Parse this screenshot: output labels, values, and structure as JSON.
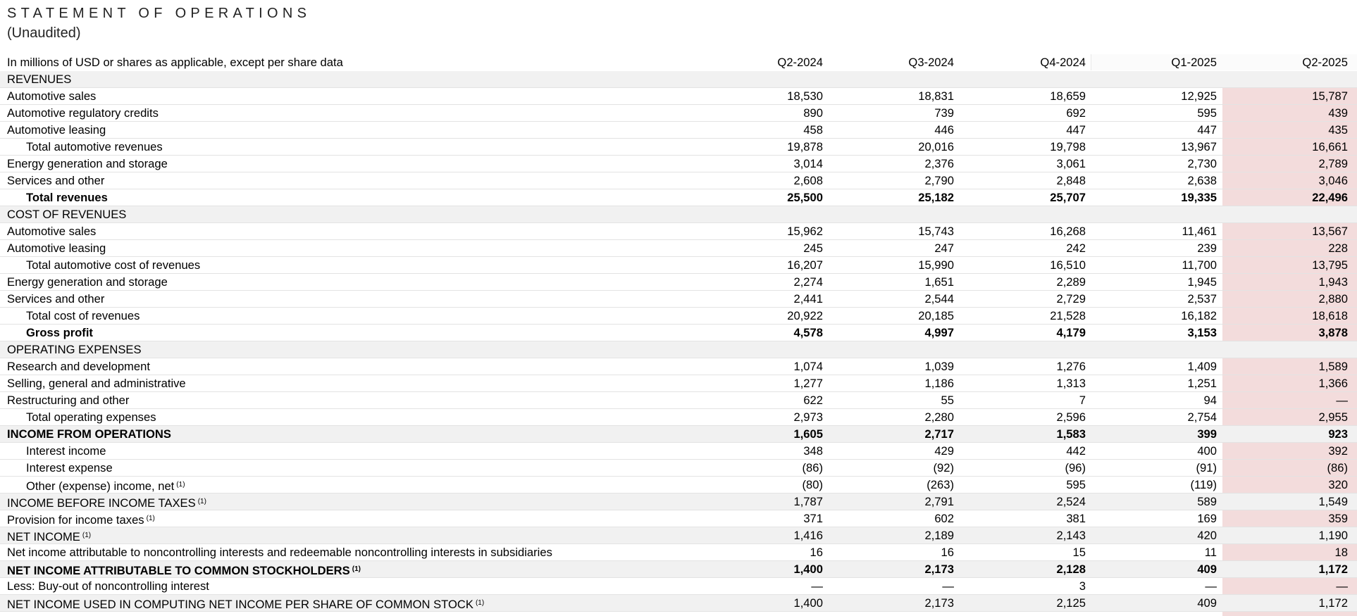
{
  "title": "STATEMENT OF OPERATIONS",
  "subtitle": "(Unaudited)",
  "header": {
    "label": "In millions of USD or shares as applicable, except per share data",
    "columns": [
      "Q2-2024",
      "Q3-2024",
      "Q4-2024",
      "Q1-2025",
      "Q2-2025"
    ]
  },
  "rows": [
    {
      "label": "REVENUES",
      "section": true
    },
    {
      "label": "Automotive sales",
      "values": [
        "18,530",
        "18,831",
        "18,659",
        "12,925",
        "15,787"
      ],
      "hl": true
    },
    {
      "label": "Automotive regulatory credits",
      "values": [
        "890",
        "739",
        "692",
        "595",
        "439"
      ],
      "hl": true
    },
    {
      "label": "Automotive leasing",
      "values": [
        "458",
        "446",
        "447",
        "447",
        "435"
      ],
      "hl": true
    },
    {
      "label": "Total automotive revenues",
      "indent": true,
      "values": [
        "19,878",
        "20,016",
        "19,798",
        "13,967",
        "16,661"
      ],
      "hl": true
    },
    {
      "label": "Energy generation and storage",
      "values": [
        "3,014",
        "2,376",
        "3,061",
        "2,730",
        "2,789"
      ],
      "hl": true
    },
    {
      "label": "Services and other",
      "values": [
        "2,608",
        "2,790",
        "2,848",
        "2,638",
        "3,046"
      ],
      "hl": true
    },
    {
      "label": "Total revenues",
      "indent": true,
      "bold": true,
      "values": [
        "25,500",
        "25,182",
        "25,707",
        "19,335",
        "22,496"
      ],
      "hl": true
    },
    {
      "label": "COST OF REVENUES",
      "section": true
    },
    {
      "label": "Automotive sales",
      "values": [
        "15,962",
        "15,743",
        "16,268",
        "11,461",
        "13,567"
      ],
      "hl": true
    },
    {
      "label": "Automotive leasing",
      "values": [
        "245",
        "247",
        "242",
        "239",
        "228"
      ],
      "hl": true
    },
    {
      "label": "Total automotive cost of revenues",
      "indent": true,
      "values": [
        "16,207",
        "15,990",
        "16,510",
        "11,700",
        "13,795"
      ],
      "hl": true
    },
    {
      "label": "Energy generation and storage",
      "values": [
        "2,274",
        "1,651",
        "2,289",
        "1,945",
        "1,943"
      ],
      "hl": true
    },
    {
      "label": "Services and other",
      "values": [
        "2,441",
        "2,544",
        "2,729",
        "2,537",
        "2,880"
      ],
      "hl": true
    },
    {
      "label": "Total cost of revenues",
      "indent": true,
      "values": [
        "20,922",
        "20,185",
        "21,528",
        "16,182",
        "18,618"
      ],
      "hl": true
    },
    {
      "label": "Gross profit",
      "indent": true,
      "bold": true,
      "values": [
        "4,578",
        "4,997",
        "4,179",
        "3,153",
        "3,878"
      ],
      "hl": true
    },
    {
      "label": "OPERATING EXPENSES",
      "section": true
    },
    {
      "label": "Research and development",
      "values": [
        "1,074",
        "1,039",
        "1,276",
        "1,409",
        "1,589"
      ],
      "hl": true
    },
    {
      "label": "Selling, general and administrative",
      "values": [
        "1,277",
        "1,186",
        "1,313",
        "1,251",
        "1,366"
      ],
      "hl": true
    },
    {
      "label": "Restructuring and other",
      "values": [
        "622",
        "55",
        "7",
        "94",
        "—"
      ],
      "hl": true
    },
    {
      "label": "Total operating expenses",
      "indent": true,
      "values": [
        "2,973",
        "2,280",
        "2,596",
        "2,754",
        "2,955"
      ],
      "hl": true
    },
    {
      "label": "INCOME FROM OPERATIONS",
      "bold": true,
      "section": true,
      "values": [
        "1,605",
        "2,717",
        "1,583",
        "399",
        "923"
      ]
    },
    {
      "label": "Interest income",
      "indent": true,
      "values": [
        "348",
        "429",
        "442",
        "400",
        "392"
      ],
      "hl": true
    },
    {
      "label": "Interest expense",
      "indent": true,
      "values": [
        "(86)",
        "(92)",
        "(96)",
        "(91)",
        "(86)"
      ],
      "hl": true
    },
    {
      "label": "Other (expense) income, net",
      "fn": "(1)",
      "indent": true,
      "values": [
        "(80)",
        "(263)",
        "595",
        "(119)",
        "320"
      ],
      "hl": true
    },
    {
      "label": "INCOME BEFORE INCOME TAXES",
      "fn": "(1)",
      "section": true,
      "values": [
        "1,787",
        "2,791",
        "2,524",
        "589",
        "1,549"
      ]
    },
    {
      "label": "Provision for income taxes",
      "fn": "(1)",
      "values": [
        "371",
        "602",
        "381",
        "169",
        "359"
      ],
      "hl": true
    },
    {
      "label": "NET INCOME",
      "fn": "(1)",
      "section": true,
      "values": [
        "1,416",
        "2,189",
        "2,143",
        "420",
        "1,190"
      ]
    },
    {
      "label": "Net income attributable to noncontrolling interests and redeemable noncontrolling interests in subsidiaries",
      "values": [
        "16",
        "16",
        "15",
        "11",
        "18"
      ],
      "hl": true
    },
    {
      "label": "NET INCOME ATTRIBUTABLE TO COMMON STOCKHOLDERS",
      "fn": "(1)",
      "bold": true,
      "section": true,
      "values": [
        "1,400",
        "2,173",
        "2,128",
        "409",
        "1,172"
      ]
    },
    {
      "label": "Less: Buy-out of noncontrolling interest",
      "values": [
        "—",
        "—",
        "3",
        "—",
        "—"
      ],
      "hl": true
    },
    {
      "label": "NET INCOME USED IN COMPUTING NET INCOME PER SHARE OF COMMON STOCK",
      "fn": "(1)",
      "section": true,
      "values": [
        "1,400",
        "2,173",
        "2,125",
        "409",
        "1,172"
      ]
    }
  ],
  "colors": {
    "highlight": "#f3dcdc",
    "section_band": "#f1f1f1",
    "rule": "#e3e3e3"
  }
}
